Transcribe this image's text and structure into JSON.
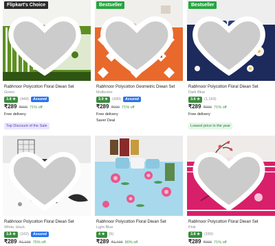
{
  "colors": {
    "rating_green": "#388e3c",
    "assured_blue": "#2874f0",
    "discount_green": "#388e3c"
  },
  "products": [
    {
      "tag": "Flipkart's Choice",
      "title": "Rabhnoor Polycotton Floral Diwan Set",
      "variant": "Green",
      "rating": "3.8 ★",
      "count": "(443)",
      "assured": "Assured",
      "price": "₹289",
      "mrp": "₹999",
      "off": "71% off",
      "delivery": "Free delivery",
      "note": "",
      "badge": "Top Discount of the Sale"
    },
    {
      "tag": "Bestseller",
      "title": "Rabhnoor Polycotton Geometric Diwan Set",
      "variant": "Multicolor",
      "rating": "3.9 ★",
      "count": "(439)",
      "assured": "Assured",
      "price": "₹289",
      "mrp": "₹999",
      "off": "71% off",
      "delivery": "Free delivery",
      "note": "Saver Deal",
      "badge": ""
    },
    {
      "tag": "Bestseller",
      "title": "Rabhnoor Polycotton Floral Diwan Set",
      "variant": "Dark Blue",
      "rating": "3.6 ★",
      "count": "(1,163)",
      "assured": "",
      "price": "₹289",
      "mrp": "₹999",
      "off": "71% off",
      "delivery": "Free delivery",
      "note": "",
      "badge": "Lowest price in the year"
    },
    {
      "tag": "",
      "title": "Rabhnoor Polycotton Floral Diwan Set",
      "variant": "White, black",
      "rating": "3.8 ★",
      "count": "(162)",
      "assured": "Assured",
      "price": "₹289",
      "mrp": "₹1,199",
      "off": "75% off",
      "delivery": "",
      "note": "",
      "badge": ""
    },
    {
      "tag": "",
      "title": "Rabhnoor Polycotton Floral Diwan Set",
      "variant": "Light Blue",
      "rating": "4 ★",
      "count": "(5)",
      "assured": "",
      "price": "₹289",
      "mrp": "₹1,499",
      "off": "80% off",
      "delivery": "",
      "note": "",
      "badge": ""
    },
    {
      "tag": "",
      "title": "Rabhnoor Polycotton Floral Diwan Set",
      "variant": "Pink",
      "rating": "3.8 ★",
      "count": "(150)",
      "assured": "",
      "price": "₹289",
      "mrp": "₹999",
      "off": "71% off",
      "delivery": "",
      "note": "",
      "badge": ""
    }
  ]
}
